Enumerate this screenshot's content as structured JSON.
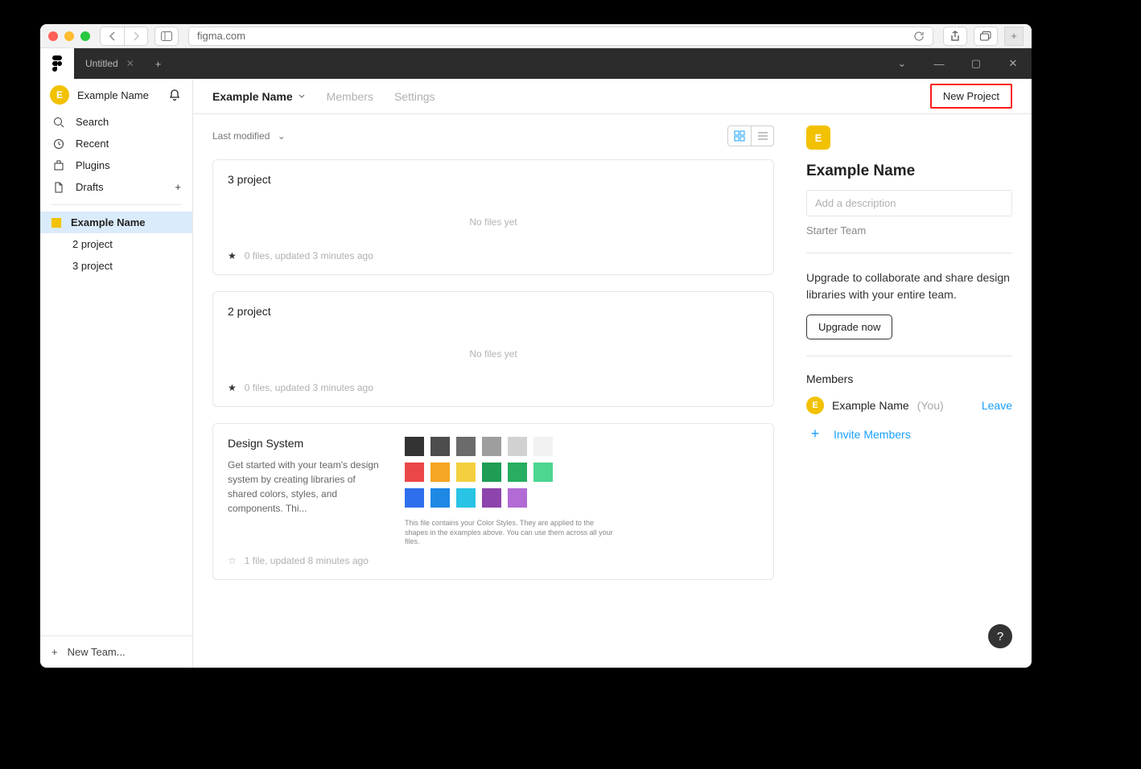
{
  "browser": {
    "url": "figma.com"
  },
  "tabbar": {
    "tab_name": "Untitled"
  },
  "sidebar": {
    "user_initial": "E",
    "user_name": "Example Name",
    "search": "Search",
    "recent": "Recent",
    "plugins": "Plugins",
    "drafts": "Drafts",
    "team": {
      "name": "Example Name",
      "projects": [
        "2 project",
        "3 project"
      ]
    },
    "new_team": "New Team..."
  },
  "header": {
    "title": "Example Name",
    "members": "Members",
    "settings": "Settings",
    "new_project": "New Project"
  },
  "sort_label": "Last modified",
  "projects": [
    {
      "title": "3 project",
      "no_files": "No files yet",
      "meta": "0 files, updated 3 minutes ago",
      "starred": true
    },
    {
      "title": "2 project",
      "no_files": "No files yet",
      "meta": "0 files, updated 3 minutes ago",
      "starred": true
    }
  ],
  "design_system": {
    "title": "Design System",
    "desc": "Get started with your team's design system by creating libraries of shared colors, styles, and components. Thi...",
    "meta": "1 file, updated 8 minutes ago",
    "palette_note": "This file contains your Color Styles. They are applied to the shapes in the examples above. You can use them across all your files.",
    "colors_row1": [
      "#333333",
      "#4d4d4d",
      "#6b6b6b",
      "#9e9e9e",
      "#d1d1d1",
      "#f2f2f2"
    ],
    "colors_row2": [
      "#eb4747",
      "#f5a623",
      "#f4d03f",
      "#1f9d55",
      "#27ae60",
      "#4cd690"
    ],
    "colors_row3": [
      "#2f6fed",
      "#1e88e5",
      "#29c3e5",
      "#8e44ad",
      "#b26bd4"
    ]
  },
  "right": {
    "initial": "E",
    "name": "Example Name",
    "desc_placeholder": "Add a description",
    "plan": "Starter Team",
    "upgrade_text": "Upgrade to collaborate and share design libraries with your entire team.",
    "upgrade_btn": "Upgrade now",
    "members_h": "Members",
    "member_name": "Example Name",
    "you": "(You)",
    "leave": "Leave",
    "invite": "Invite Members"
  },
  "help": "?"
}
